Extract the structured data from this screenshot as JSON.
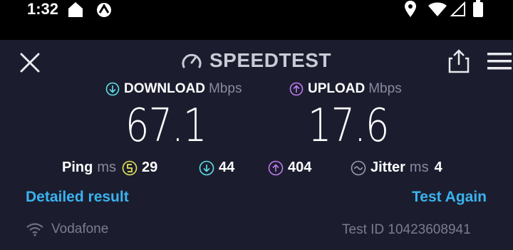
{
  "status": {
    "time": "1:32"
  },
  "header": {
    "title": "SPEEDTEST"
  },
  "download": {
    "label": "DOWNLOAD",
    "unit": "Mbps",
    "value": "67.1",
    "color": "#5ee0e6"
  },
  "upload": {
    "label": "UPLOAD",
    "unit": "Mbps",
    "value": "17.6",
    "color": "#bf7af0"
  },
  "stats": {
    "ping_label": "Ping",
    "ping_unit": "ms",
    "ping_value": "29",
    "download_latency": "44",
    "upload_latency": "404",
    "jitter_label": "Jitter",
    "jitter_unit": "ms",
    "jitter_value": "4",
    "ping_color": "#e6e35a"
  },
  "actions": {
    "detailed": "Detailed result",
    "again": "Test Again"
  },
  "footer": {
    "network": "Vodafone",
    "test_id": "Test ID 10423608941"
  },
  "icons": [
    "close-icon",
    "speedometer-icon",
    "share-icon",
    "menu-icon",
    "download-arrow-icon",
    "upload-arrow-icon",
    "ping-icon",
    "jitter-icon",
    "wifi-icon"
  ]
}
